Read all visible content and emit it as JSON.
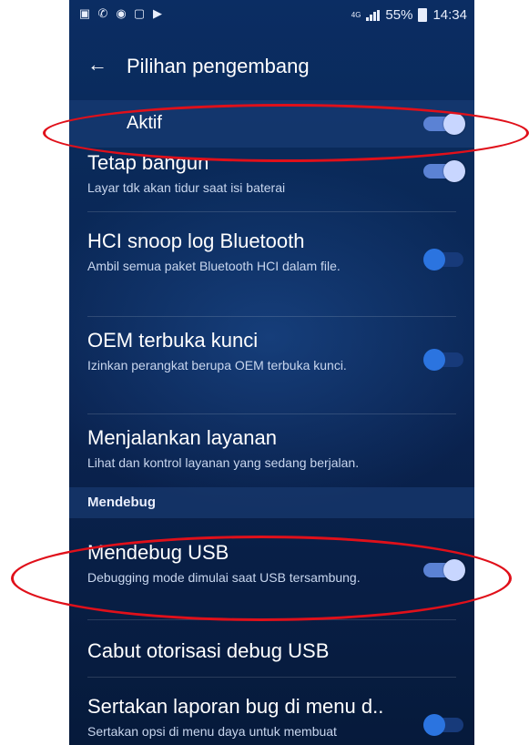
{
  "status_bar": {
    "left_icons": [
      "gallery-icon",
      "whatsapp-icon",
      "wifi-hotspot-icon",
      "cast-icon",
      "play-store-icon"
    ],
    "network": "4G",
    "battery_percent": "55%",
    "time": "14:34"
  },
  "app_bar": {
    "title": "Pilihan pengembang"
  },
  "master_toggle": {
    "label": "Aktif",
    "on": true
  },
  "settings": [
    {
      "title": "Tetap bangun",
      "subtitle": "Layar tdk akan tidur saat isi baterai",
      "toggle": "on"
    },
    {
      "title": "HCI snoop log Bluetooth",
      "subtitle": "Ambil semua paket Bluetooth HCI dalam file.",
      "toggle": "off"
    },
    {
      "title": "OEM terbuka kunci",
      "subtitle": "Izinkan perangkat berupa OEM terbuka kunci.",
      "toggle": "off"
    },
    {
      "title": "Menjalankan layanan",
      "subtitle": "Lihat dan kontrol layanan yang sedang berjalan."
    }
  ],
  "debug_section": {
    "header": "Mendebug",
    "items": [
      {
        "title": "Mendebug USB",
        "subtitle": "Debugging mode dimulai saat USB tersambung.",
        "toggle": "on"
      },
      {
        "title": "Cabut otorisasi debug USB"
      },
      {
        "title": "Sertakan laporan bug di menu d..",
        "subtitle": "Sertakan opsi di menu daya untuk membuat",
        "toggle": "off"
      }
    ]
  },
  "colors": {
    "highlight_ring": "#e0101a",
    "toggle_on": "#5b82d4",
    "toggle_off": "#2b74e0"
  }
}
